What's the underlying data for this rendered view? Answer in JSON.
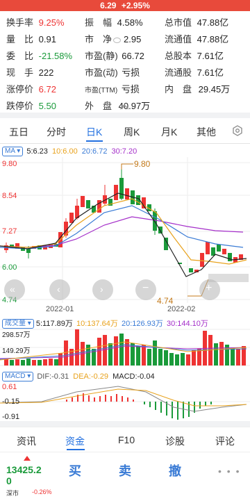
{
  "header": {
    "price": "6.29",
    "change_pct": "+2.95%"
  },
  "stats": {
    "row1": [
      {
        "label": "换手率",
        "value": "9.25%"
      },
      {
        "label": "振　幅",
        "value": "4.58%"
      },
      {
        "label": "总市值",
        "value": "47.88亿"
      }
    ],
    "row2": [
      {
        "label": "量　比",
        "value": "0.91"
      },
      {
        "label": "市　净",
        "value": "2.95"
      },
      {
        "label": "流通值",
        "value": "47.88亿"
      }
    ],
    "row3": [
      {
        "label": "委　比",
        "value": "-21.58%"
      },
      {
        "label": "市盈(静)",
        "value": "66.72"
      },
      {
        "label": "总股本",
        "value": "7.61亿"
      }
    ],
    "row4": [
      {
        "label": "现　手",
        "value": "222"
      },
      {
        "label": "市盈(动)",
        "value": "亏损"
      },
      {
        "label": "流通股",
        "value": "7.61亿"
      }
    ],
    "row5": [
      {
        "label": "涨停价",
        "value": "6.72"
      },
      {
        "label": "市盈(TTM)",
        "value": "亏损"
      },
      {
        "label": "内　盘",
        "value": "29.45万"
      }
    ],
    "row6": [
      {
        "label": "跌停价",
        "value": "5.50"
      },
      {
        "label": "外　盘",
        "value": "40.97万"
      }
    ]
  },
  "periods": [
    "五日",
    "分时",
    "日K",
    "周K",
    "月K",
    "其他"
  ],
  "active_period": "日K",
  "ma_legend": {
    "tag": "MA",
    "ma5": "5:6.23",
    "ma10": "10:6.00",
    "ma20": "20:6.72",
    "ma30": "30:7.20"
  },
  "price_axis": {
    "p1": "9.80",
    "p2": "8.54",
    "p3": "7.27",
    "p4": "6.00",
    "p5": "4.74"
  },
  "annotations": {
    "high": "9.80",
    "low": "4.74"
  },
  "dates": {
    "d1": "2022-01",
    "d2": "2022-02"
  },
  "vol_legend": {
    "tag": "成交量",
    "v5": "5:117.89万",
    "v10": "10:137.64万",
    "v20": "20:126.93万",
    "v30": "30:144.10万"
  },
  "vol_axis": {
    "top": "298.57万",
    "mid": "149.29万"
  },
  "macd_legend": {
    "tag": "MACD",
    "dif": "DIF:-0.31",
    "dea": "DEA:-0.29",
    "macd": "MACD:-0.04"
  },
  "macd_axis": {
    "top": "0.61",
    "mid": "-0.15",
    "bot": "-0.91"
  },
  "bottom_tabs": [
    "资讯",
    "资金",
    "F10",
    "诊股",
    "评论"
  ],
  "active_bottom_tab": "资金",
  "index": {
    "value": "13425.20",
    "name": "深市",
    "change": "-0.26%"
  },
  "actions": {
    "buy": "买",
    "sell": "卖",
    "cancel": "撤",
    "more": "• • •"
  },
  "colors": {
    "up": "#e33333",
    "down": "#1a9a3a",
    "accent": "#2270e0",
    "ma5": "#222222",
    "ma10": "#e8a21c",
    "ma20": "#3a7bd5",
    "ma30": "#a42ec9"
  }
}
